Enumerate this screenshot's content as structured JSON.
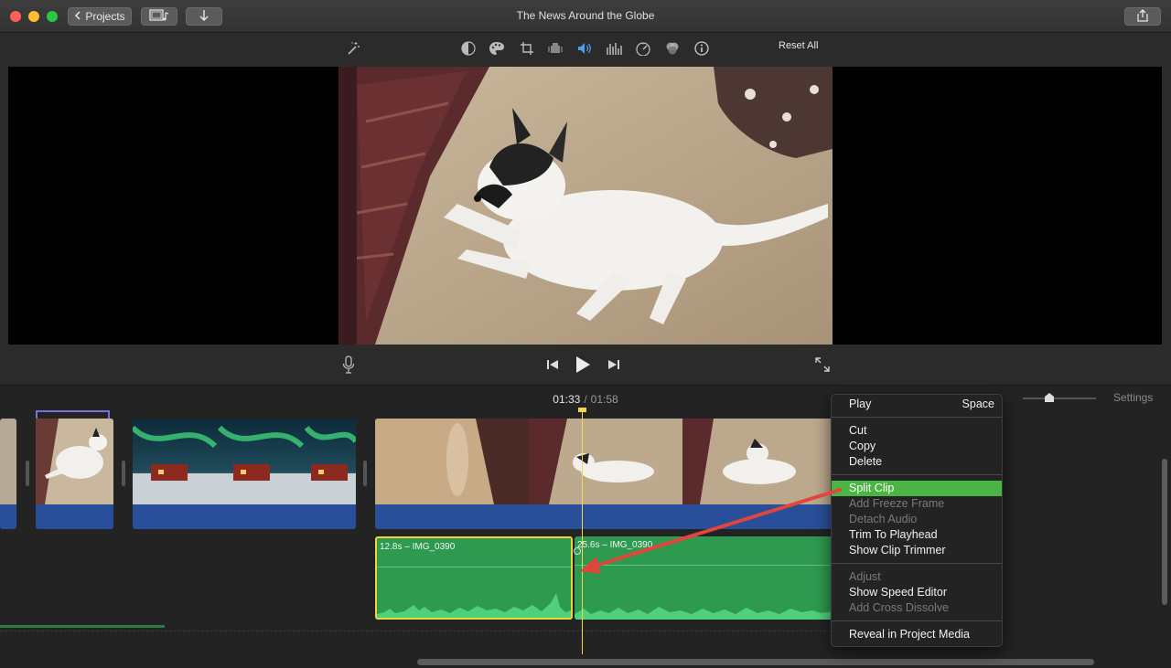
{
  "window": {
    "title": "The News Around the Globe",
    "projects_label": "Projects"
  },
  "viewer_toolbar": {
    "icons": [
      "magic-wand-icon",
      "color-balance-icon",
      "color-correction-icon",
      "crop-icon",
      "stabilization-icon",
      "volume-icon",
      "equalizer-icon",
      "speed-icon",
      "clip-filter-icon",
      "info-icon"
    ],
    "reset_label": "Reset All"
  },
  "timeline": {
    "current_time": "01:33",
    "separator": "/",
    "total_time": "01:58",
    "settings_label": "Settings",
    "audio_clips": [
      {
        "label": "12.8s – IMG_0390",
        "selected": true
      },
      {
        "label": "25.6s – IMG_0390",
        "selected": false
      }
    ]
  },
  "context_menu": {
    "groups": [
      [
        {
          "label": "Play",
          "shortcut": "Space",
          "enabled": true
        }
      ],
      [
        {
          "label": "Cut",
          "enabled": true
        },
        {
          "label": "Copy",
          "enabled": true
        },
        {
          "label": "Delete",
          "enabled": true
        }
      ],
      [
        {
          "label": "Split Clip",
          "enabled": true,
          "highlighted": true
        },
        {
          "label": "Add Freeze Frame",
          "enabled": false
        },
        {
          "label": "Detach Audio",
          "enabled": false
        },
        {
          "label": "Trim To Playhead",
          "enabled": true
        },
        {
          "label": "Show Clip Trimmer",
          "enabled": true
        }
      ],
      [
        {
          "label": "Adjust",
          "enabled": false
        },
        {
          "label": "Show Speed Editor",
          "enabled": true
        },
        {
          "label": "Add Cross Dissolve",
          "enabled": false
        }
      ],
      [
        {
          "label": "Reveal in Project Media",
          "enabled": true
        }
      ]
    ]
  },
  "colors": {
    "accent_blue": "#4a9df0",
    "menu_highlight": "#4bb543",
    "playhead": "#f3d64a",
    "audio_track": "#2e9a4f",
    "video_bar": "#2a4f9a",
    "annotation_arrow": "#e0463c"
  }
}
